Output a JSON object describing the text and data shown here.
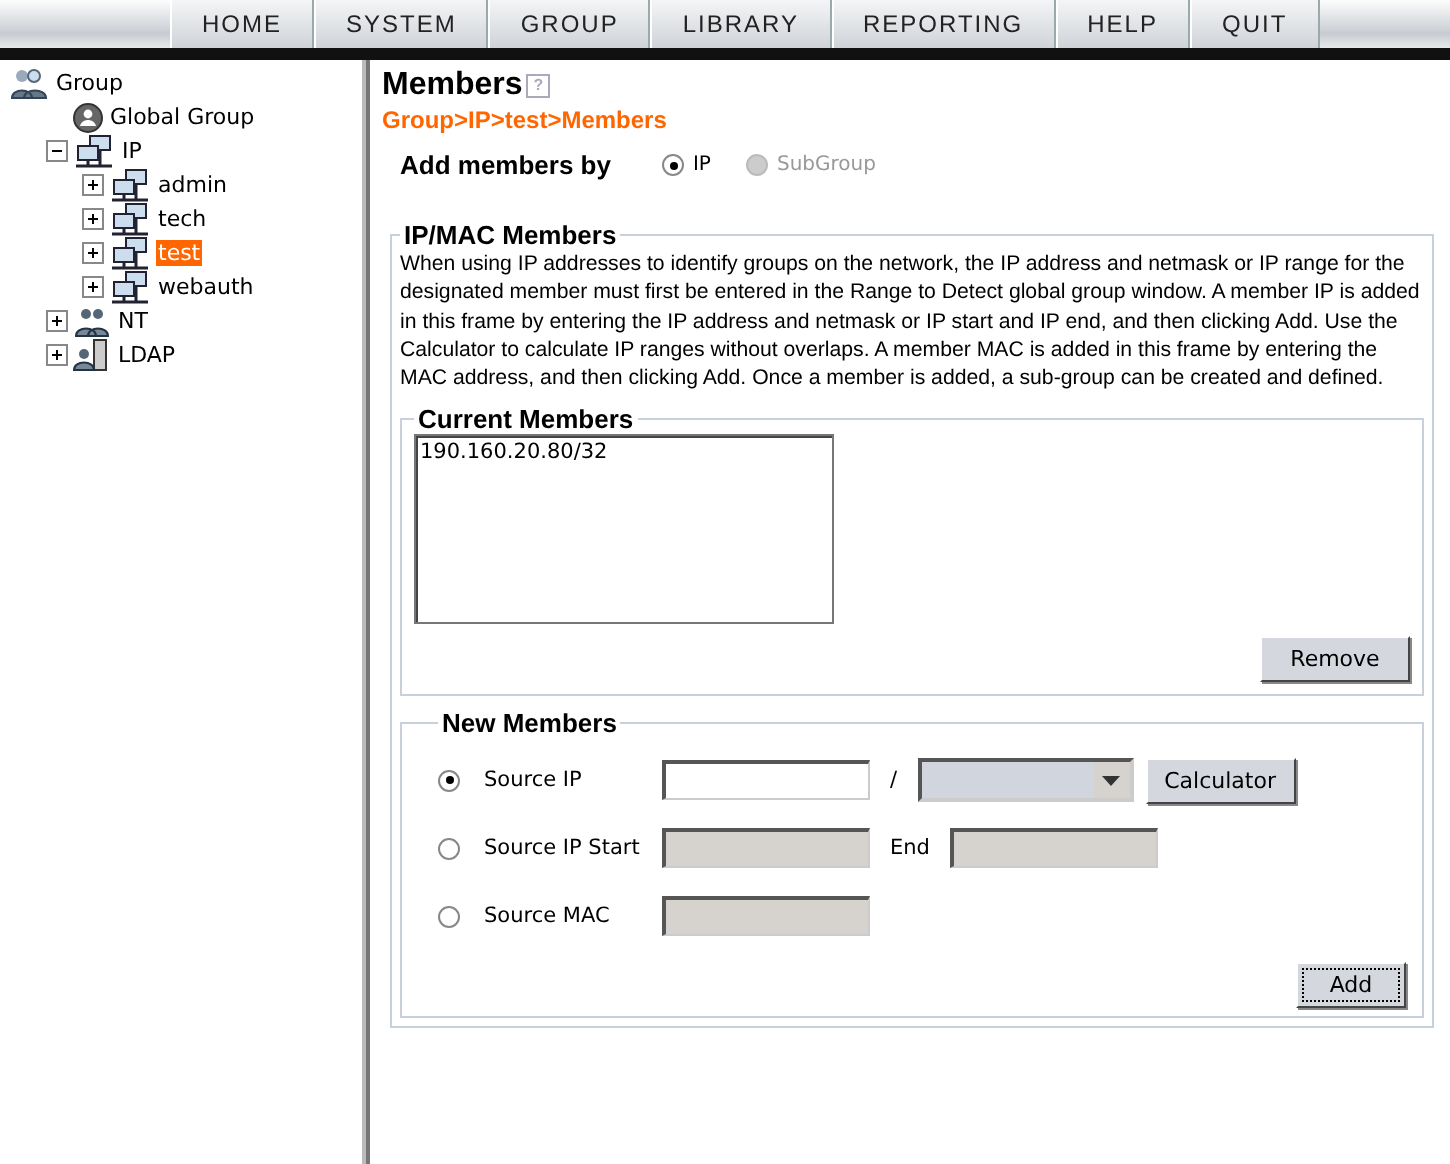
{
  "nav": {
    "items": [
      {
        "label": "HOME"
      },
      {
        "label": "SYSTEM"
      },
      {
        "label": "GROUP"
      },
      {
        "label": "LIBRARY"
      },
      {
        "label": "REPORTING"
      },
      {
        "label": "HELP"
      },
      {
        "label": "QUIT"
      }
    ]
  },
  "tree": {
    "label": "Group",
    "kind": "group",
    "selected": false,
    "children": [
      {
        "label": "Global Group",
        "kind": "global",
        "selected": false
      },
      {
        "label": "IP",
        "kind": "ip",
        "selected": false,
        "expanded": true,
        "children": [
          {
            "label": "admin",
            "kind": "ip",
            "selected": false,
            "expanded": false
          },
          {
            "label": "tech",
            "kind": "ip",
            "selected": false,
            "expanded": false
          },
          {
            "label": "test",
            "kind": "ip",
            "selected": true,
            "expanded": false
          },
          {
            "label": "webauth",
            "kind": "ip",
            "selected": false,
            "expanded": false
          }
        ]
      },
      {
        "label": "NT",
        "kind": "nt",
        "selected": false,
        "expanded": false
      },
      {
        "label": "LDAP",
        "kind": "ldap",
        "selected": false,
        "expanded": false
      }
    ]
  },
  "page": {
    "title": "Members",
    "help_icon": "?",
    "breadcrumb": "Group>IP>test>Members",
    "add_members_by": {
      "label": "Add members by",
      "options": [
        {
          "label": "IP",
          "selected": true,
          "disabled": false
        },
        {
          "label": "SubGroup",
          "selected": false,
          "disabled": true
        }
      ]
    },
    "ip_mac_members": {
      "title": "IP/MAC Members",
      "description": "When using IP addresses to identify groups on the network, the IP address and netmask or IP range for the designated member must first be entered in the Range to Detect global group window. A member IP is added in this frame by entering the IP address and netmask or IP start and IP end, and then clicking Add. Use the Calculator to calculate IP ranges without overlaps. A member MAC is added in this frame by entering the MAC address, and then clicking Add. Once a member is added, a sub-group can be created and defined.",
      "current_members": {
        "title": "Current Members",
        "entries": [
          "190.160.20.80/32"
        ],
        "remove_button": "Remove"
      },
      "new_members": {
        "title": "New Members",
        "rows": [
          {
            "label": "Source IP",
            "selected": true,
            "fields": [
              {
                "kind": "input",
                "disabled": false
              },
              {
                "kind": "text",
                "text": "/"
              },
              {
                "kind": "select",
                "disabled": false
              },
              {
                "kind": "button",
                "text": "Calculator"
              }
            ]
          },
          {
            "label": "Source IP Start",
            "selected": false,
            "fields": [
              {
                "kind": "input",
                "disabled": true
              },
              {
                "kind": "text",
                "text": "End"
              },
              {
                "kind": "input",
                "disabled": true
              }
            ]
          },
          {
            "label": "Source MAC",
            "selected": false,
            "fields": [
              {
                "kind": "input",
                "disabled": true
              }
            ]
          }
        ],
        "add_button": "Add"
      }
    }
  }
}
